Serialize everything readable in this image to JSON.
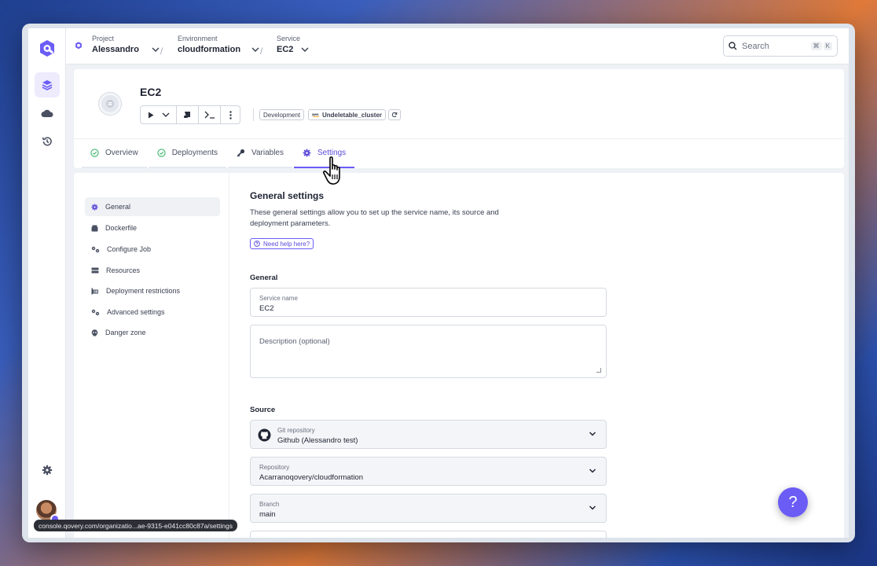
{
  "topbar": {
    "project": {
      "label": "Project",
      "value": "Alessandro"
    },
    "environment": {
      "label": "Environment",
      "value": "cloudformation"
    },
    "service": {
      "label": "Service",
      "value": "EC2"
    },
    "search": {
      "placeholder": "Search",
      "shortcut_mod": "⌘",
      "shortcut_key": "K"
    }
  },
  "rail": {
    "icons": [
      "qovery-logo-icon",
      "layers-icon",
      "cloud-icon",
      "history-icon",
      "settings-gear-icon"
    ]
  },
  "header": {
    "title": "EC2",
    "tags": {
      "environment_type": "Development",
      "cluster": "Undeletable_cluster"
    },
    "tabs": [
      {
        "label": "Overview",
        "icon": "check-circle-icon"
      },
      {
        "label": "Deployments",
        "icon": "check-circle-icon"
      },
      {
        "label": "Variables",
        "icon": "key-icon"
      },
      {
        "label": "Settings",
        "icon": "gear-icon",
        "active": true
      }
    ]
  },
  "sidenav": {
    "items": [
      {
        "label": "General",
        "active": true
      },
      {
        "label": "Dockerfile"
      },
      {
        "label": "Configure Job"
      },
      {
        "label": "Resources"
      },
      {
        "label": "Deployment restrictions"
      },
      {
        "label": "Advanced settings"
      },
      {
        "label": "Danger zone"
      }
    ]
  },
  "content": {
    "title": "General settings",
    "description": "These general settings allow you to set up the service name, its source and deployment parameters.",
    "help_label": "Need help here?",
    "general_heading": "General",
    "service_name": {
      "label": "Service name",
      "value": "EC2"
    },
    "description_field": {
      "placeholder": "Description (optional)"
    },
    "source_heading": "Source",
    "git_repository": {
      "label": "Git repository",
      "value": "Github (Alessandro test)"
    },
    "repository": {
      "label": "Repository",
      "value": "Acarranoqovery/cloudformation"
    },
    "branch": {
      "label": "Branch",
      "value": "main"
    }
  },
  "statusbar": {
    "url": "console.qovery.com/organizatio...ae-9315-e041cc80c87a/settings"
  },
  "fab": {
    "label": "?"
  },
  "colors": {
    "accent": "#6b5cf5",
    "success": "#3bb56a"
  }
}
